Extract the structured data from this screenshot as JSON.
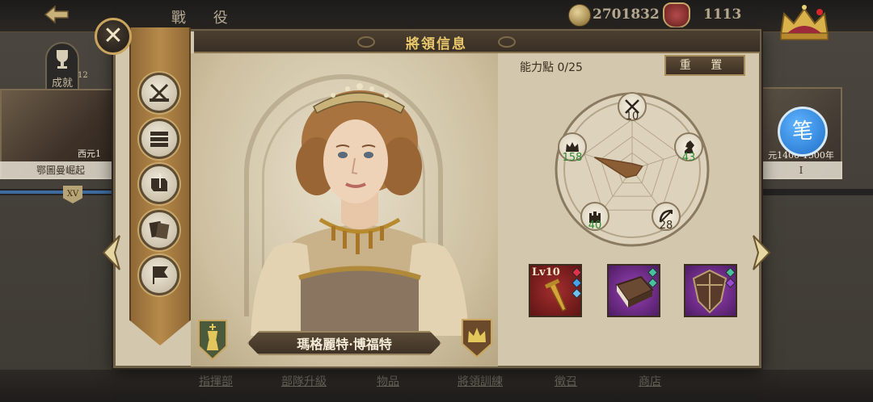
{
  "topbar": {
    "back_icon": "back-arrow-icon",
    "title": "戰 役",
    "coins": "2701832",
    "seals": "1113"
  },
  "background": {
    "left_card_label": "鄂圖曼崛起",
    "left_card_year": "西元1",
    "left_card_level": "12",
    "achievement_label": "成就",
    "timeline_marker": "XV",
    "right_card_label": "I",
    "right_card_year": "元1400-1500年",
    "brush_icon_text": "笔",
    "bottom_tabs": [
      "指揮部",
      "部隊升級",
      "物品",
      "將領訓練",
      "徵召",
      "商店"
    ]
  },
  "dialog": {
    "title": "將領信息",
    "close_icon": "close-icon",
    "ability_points_label": "能力點 0/25",
    "reset_label": "重 置",
    "general_name": "瑪格麗特·博福特",
    "side_buttons": [
      "stats-swords-icon",
      "troops-icon",
      "scroll-sword-icon",
      "skill-cards-icon",
      "banner-sword-icon"
    ],
    "stats": {
      "attack": {
        "icon": "crossed-swords-icon",
        "value": "10",
        "color": "#3b2e20"
      },
      "cavalry": {
        "icon": "knight-horse-icon",
        "value": "43",
        "color": "#2f8a2f"
      },
      "archery": {
        "icon": "bow-arrow-icon",
        "value": "28",
        "color": "#3b2e20"
      },
      "infantry": {
        "icon": "castle-tower-icon",
        "value": "40",
        "color": "#2f8a2f"
      },
      "command": {
        "icon": "crown-icon",
        "value": "158",
        "color": "#2f8a2f"
      }
    },
    "radar_values": {
      "attack": 10,
      "cavalry": 43,
      "archery": 28,
      "infantry": 40,
      "command": 158,
      "max": 200
    },
    "equipment": [
      {
        "name": "golden-dagger-item",
        "level": "Lv10",
        "rarity_color": "#a52e2e"
      },
      {
        "name": "ancient-book-item",
        "level": "",
        "rarity_color": "#9a43b8"
      },
      {
        "name": "kite-shield-item",
        "level": "",
        "rarity_color": "#9a43b8"
      }
    ],
    "accent_gold": "#e7c66c"
  }
}
